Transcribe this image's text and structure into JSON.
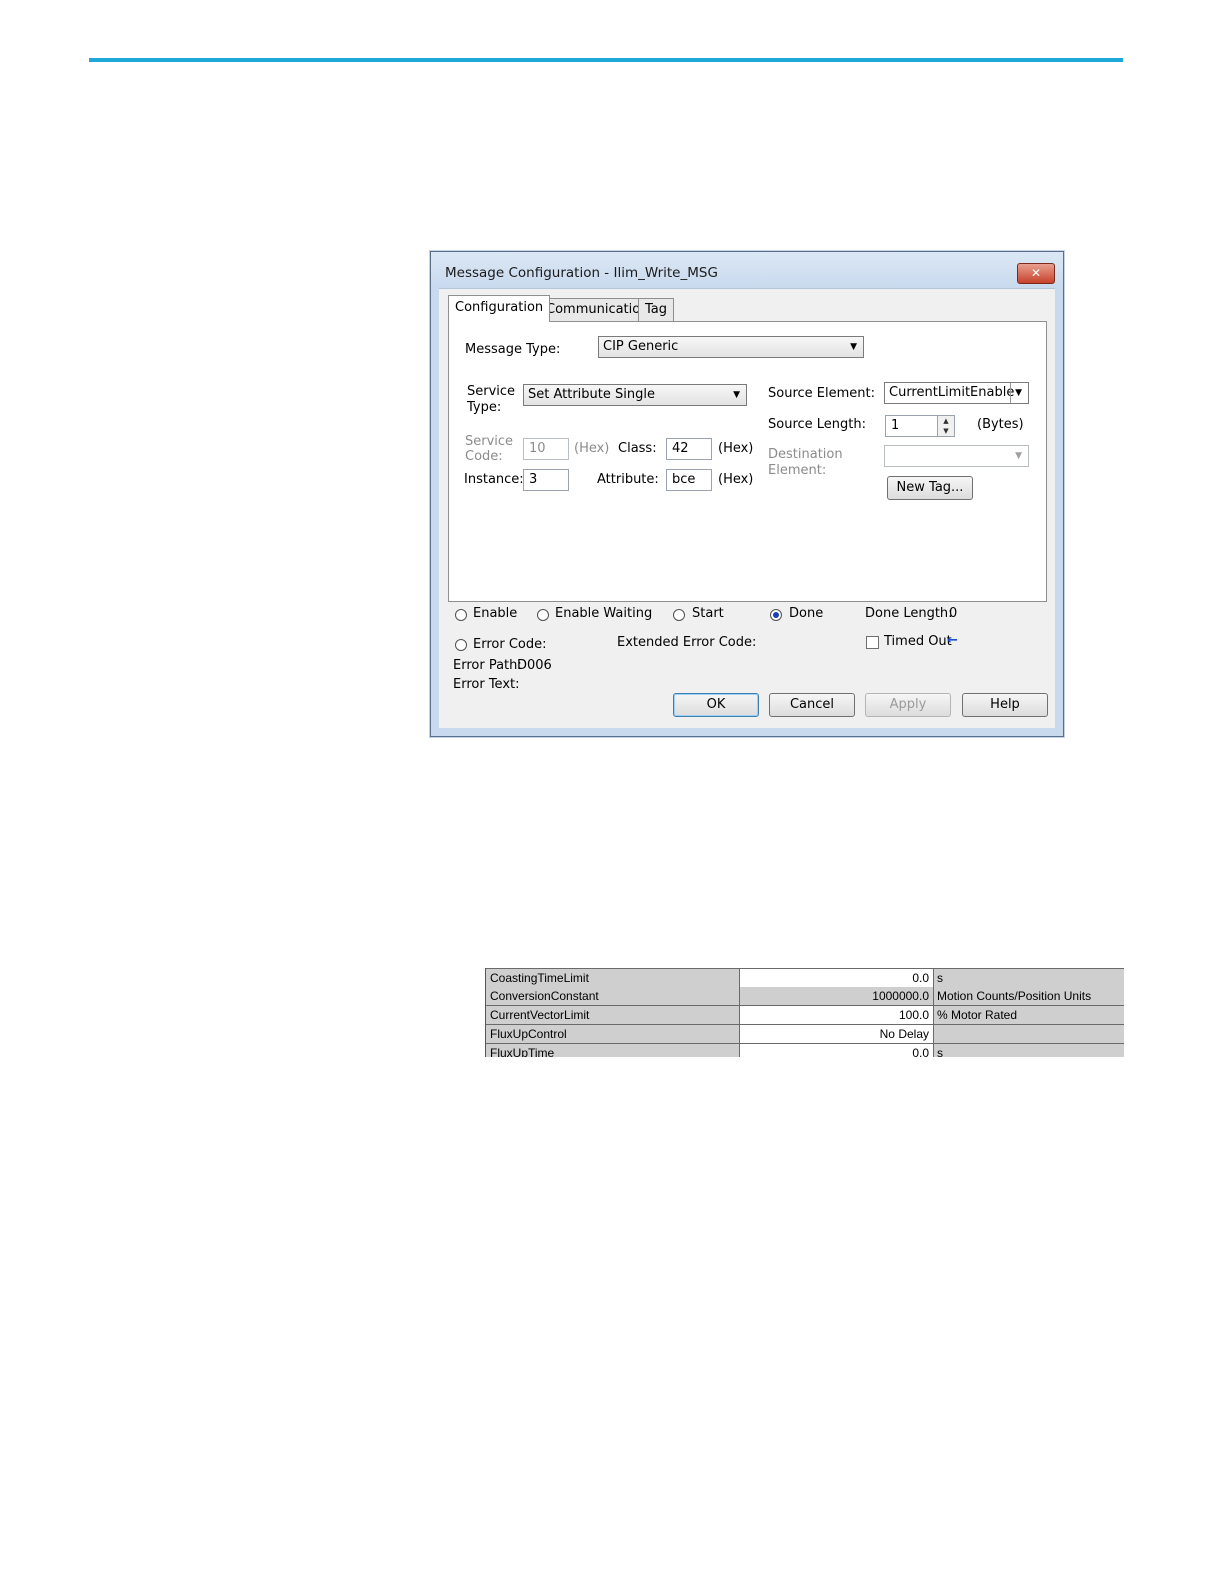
{
  "dialog": {
    "title": "Message Configuration - Ilim_Write_MSG",
    "close_glyph": "✕",
    "tabs": [
      "Configuration",
      "Communication",
      "Tag"
    ],
    "message_type_label": "Message Type:",
    "message_type_value": "CIP Generic",
    "service_type_label_1": "Service",
    "service_type_label_2": "Type:",
    "service_type_value": "Set Attribute Single",
    "service_code_label_1": "Service",
    "service_code_label_2": "Code:",
    "service_code_value": "10",
    "hex": "(Hex)",
    "class_label": "Class:",
    "class_value": "42",
    "instance_label": "Instance:",
    "instance_value": "3",
    "attribute_label": "Attribute:",
    "attribute_value": "bce",
    "source_element_label": "Source Element:",
    "source_element_value": "CurrentLimitEnable",
    "source_length_label": "Source Length:",
    "source_length_value": "1",
    "bytes_label": "(Bytes)",
    "destination_label_1": "Destination",
    "destination_label_2": "Element:",
    "destination_value": "",
    "new_tag_button": "New Tag...",
    "status": {
      "enable": "Enable",
      "enable_waiting": "Enable Waiting",
      "start": "Start",
      "done": "Done",
      "done_length_label": "Done Length:",
      "done_length_value": "0",
      "error_code_label": "Error Code:",
      "extended_error_code_label": "Extended Error Code:",
      "timed_out_label": "Timed Out",
      "error_path_label": "Error Path:",
      "error_path_value": "D006",
      "error_text_label": "Error Text:"
    },
    "buttons": {
      "ok": "OK",
      "cancel": "Cancel",
      "apply": "Apply",
      "help": "Help"
    }
  },
  "parameter_table": {
    "rows": [
      {
        "name": "CoastingTimeLimit",
        "value": "0.0",
        "unit": "s"
      },
      {
        "name": "ConversionConstant",
        "value": "1000000.0",
        "unit": "Motion Counts/Position Units"
      },
      {
        "name": "CurrentVectorLimit",
        "value": "100.0",
        "unit": "% Motor Rated"
      },
      {
        "name": "FluxUpControl",
        "value": "No Delay",
        "unit": ""
      },
      {
        "name": "FluxUpTime",
        "value": "0.0",
        "unit": "s"
      }
    ]
  },
  "colors": {
    "accent_rule": "#1ea7d9",
    "radio_selected": "#1a3fb8"
  }
}
